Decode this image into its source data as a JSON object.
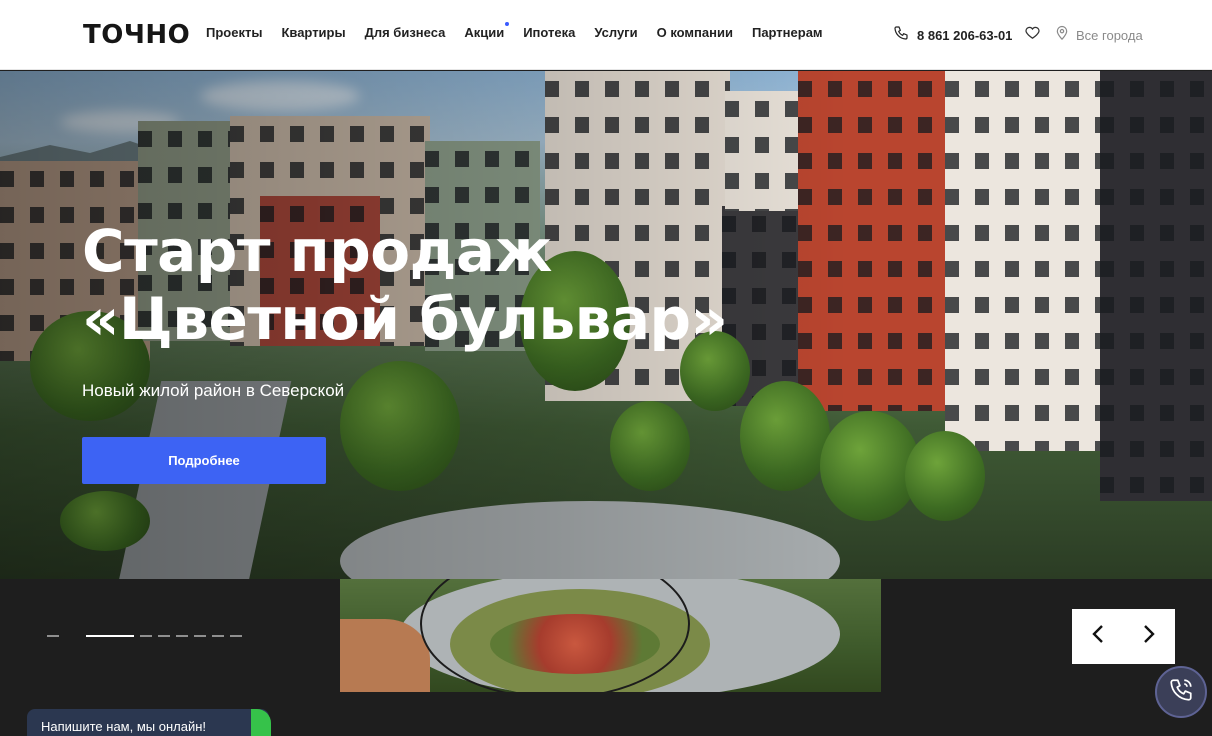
{
  "header": {
    "logo": "ТОЧНО",
    "nav": [
      {
        "label": "Проекты"
      },
      {
        "label": "Квартиры"
      },
      {
        "label": "Для бизнеса"
      },
      {
        "label": "Акции",
        "badge": true
      },
      {
        "label": "Ипотека"
      },
      {
        "label": "Услуги"
      },
      {
        "label": "О компании"
      },
      {
        "label": "Партнерам"
      }
    ],
    "phone": "8 861 206-63-01",
    "city": "Все города"
  },
  "hero": {
    "title_line1": "Старт продаж",
    "title_line2": "«Цветной бульвар»",
    "subtitle": "Новый жилой район в Северской",
    "button": "Подробнее"
  },
  "slider": {
    "slide_count": 8,
    "active_index": 1
  },
  "chat": {
    "label": "Напишите нам, мы онлайн!"
  },
  "colors": {
    "accent": "#3d63f4",
    "online": "#36c24a",
    "dark_band": "#1e1e1e"
  }
}
